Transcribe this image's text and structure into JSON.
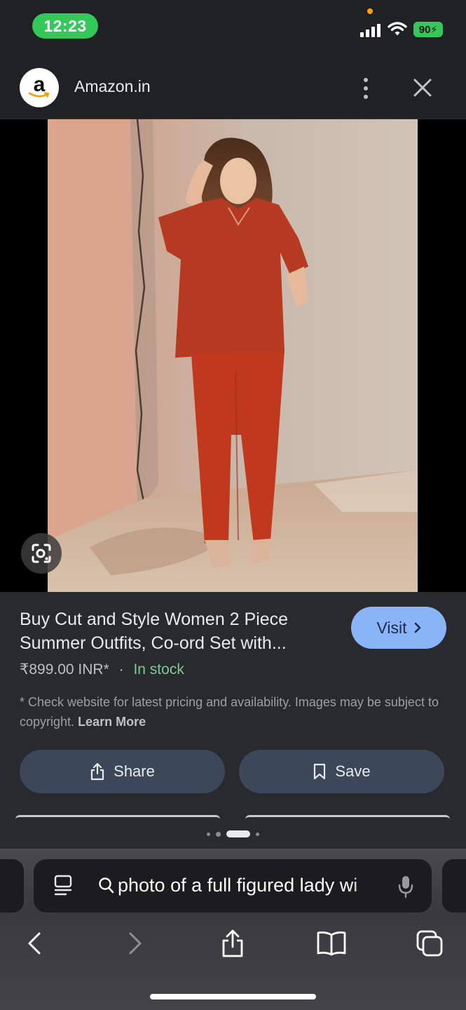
{
  "status_bar": {
    "time": "12:23",
    "battery": "90",
    "colors": {
      "time_pill": "#34c759",
      "battery": "#34c759",
      "privacy_dot": "#ff9f0a"
    },
    "icons": [
      "cellular-signal-icon",
      "wifi-icon",
      "battery-charging-icon"
    ]
  },
  "header": {
    "logo_letter": "a",
    "site_name": "Amazon.in",
    "icons": [
      "more-vert-icon",
      "close-icon"
    ]
  },
  "image": {
    "alt": "Buy Cut and Style Women 2 Piece Summer Outfits, Co-ord Set with...",
    "lens_icon": "google-lens-icon"
  },
  "product": {
    "title": "Buy Cut and Style Women 2 Piece Summer Outfits, Co-ord Set with...",
    "visit_label": "Visit",
    "price": "₹899.00 INR*",
    "separator": "·",
    "stock": "In stock",
    "disclaimer": "* Check website for latest pricing and availability. Images may be subject to copyright.",
    "learn_more": "Learn More",
    "share_label": "Share",
    "save_label": "Save",
    "carousel_pages": 4,
    "carousel_active_page": 3,
    "accent_color": "#8ab4f8",
    "stock_color": "#81c995"
  },
  "browser": {
    "search_query": "photo of a full figured lady wi",
    "icons": [
      "reader-mode-icon",
      "search-icon",
      "microphone-icon",
      "back-icon",
      "forward-icon",
      "share-icon",
      "bookmarks-icon",
      "tabs-icon"
    ]
  }
}
